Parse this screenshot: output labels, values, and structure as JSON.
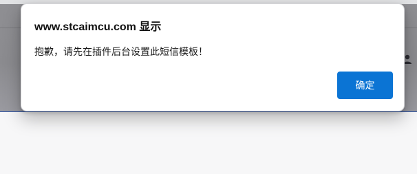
{
  "dialog": {
    "title": "www.stcaimcu.com 显示",
    "message": "抱歉，请先在插件后台设置此短信模板！",
    "confirm_label": "确定"
  },
  "colors": {
    "accent": "#0b74d4",
    "page_background": "#f7f7f8",
    "overlay": "#8f8f93"
  },
  "icons": {
    "avatar": "user-icon"
  }
}
